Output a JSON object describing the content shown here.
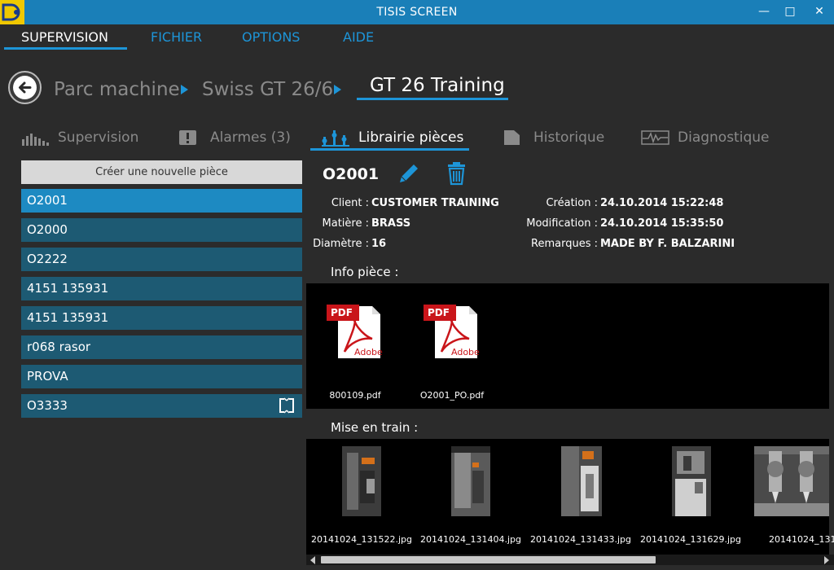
{
  "window": {
    "title": "TISIS SCREEN",
    "controls": {
      "minimize": "—",
      "maximize": "□",
      "close": "✕"
    }
  },
  "menu": [
    {
      "label": "SUPERVISION",
      "active": true
    },
    {
      "label": "FICHIER"
    },
    {
      "label": "OPTIONS"
    },
    {
      "label": "AIDE"
    }
  ],
  "breadcrumb": {
    "items": [
      "Parc machine",
      "Swiss GT 26/6"
    ],
    "current": "GT 26 Training"
  },
  "tabs": [
    {
      "label": "Supervision",
      "icon": "bars-chart-icon"
    },
    {
      "label": "Alarmes (3)",
      "icon": "alert-icon"
    },
    {
      "label": "Librairie pièces",
      "icon": "parts-library-icon",
      "active": true
    },
    {
      "label": "Historique",
      "icon": "history-icon"
    },
    {
      "label": "Diagnostique",
      "icon": "diagnostic-icon"
    }
  ],
  "sidebar": {
    "create_label": "Créer une nouvelle pièce",
    "parts": [
      "O2001",
      "O2000",
      "O2222",
      "4151 135931",
      "4151 135931",
      "r068 rasor",
      "PROVA",
      "O3333"
    ],
    "selected_index": 0
  },
  "part": {
    "name": "O2001",
    "fields": {
      "client_label": "Client :",
      "client": "CUSTOMER TRAINING",
      "matiere_label": "Matière :",
      "matiere": "BRASS",
      "diametre_label": "Diamètre :",
      "diametre": "16",
      "creation_label": "Création :",
      "creation": "24.10.2014 15:22:48",
      "modification_label": "Modification :",
      "modification": "24.10.2014 15:35:50",
      "remarques_label": "Remarques :",
      "remarques": "MADE BY F. BALZARINI"
    },
    "info_title": "Info pièce :",
    "info_files": [
      {
        "badge": "PDF",
        "brand": "Adobe",
        "name": "800109.pdf"
      },
      {
        "badge": "PDF",
        "brand": "Adobe",
        "name": "O2001_PO.pdf"
      }
    ],
    "setup_title": "Mise en train :",
    "setup_files": [
      "20141024_131522.jpg",
      "20141024_131404.jpg",
      "20141024_131433.jpg",
      "20141024_131629.jpg",
      "20141024_131"
    ]
  },
  "colors": {
    "accent": "#1d95d8",
    "titlebar": "#1a7fb8",
    "list_item": "#1d5a73",
    "list_selected": "#1d8ac2",
    "background": "#2b2b2b"
  }
}
